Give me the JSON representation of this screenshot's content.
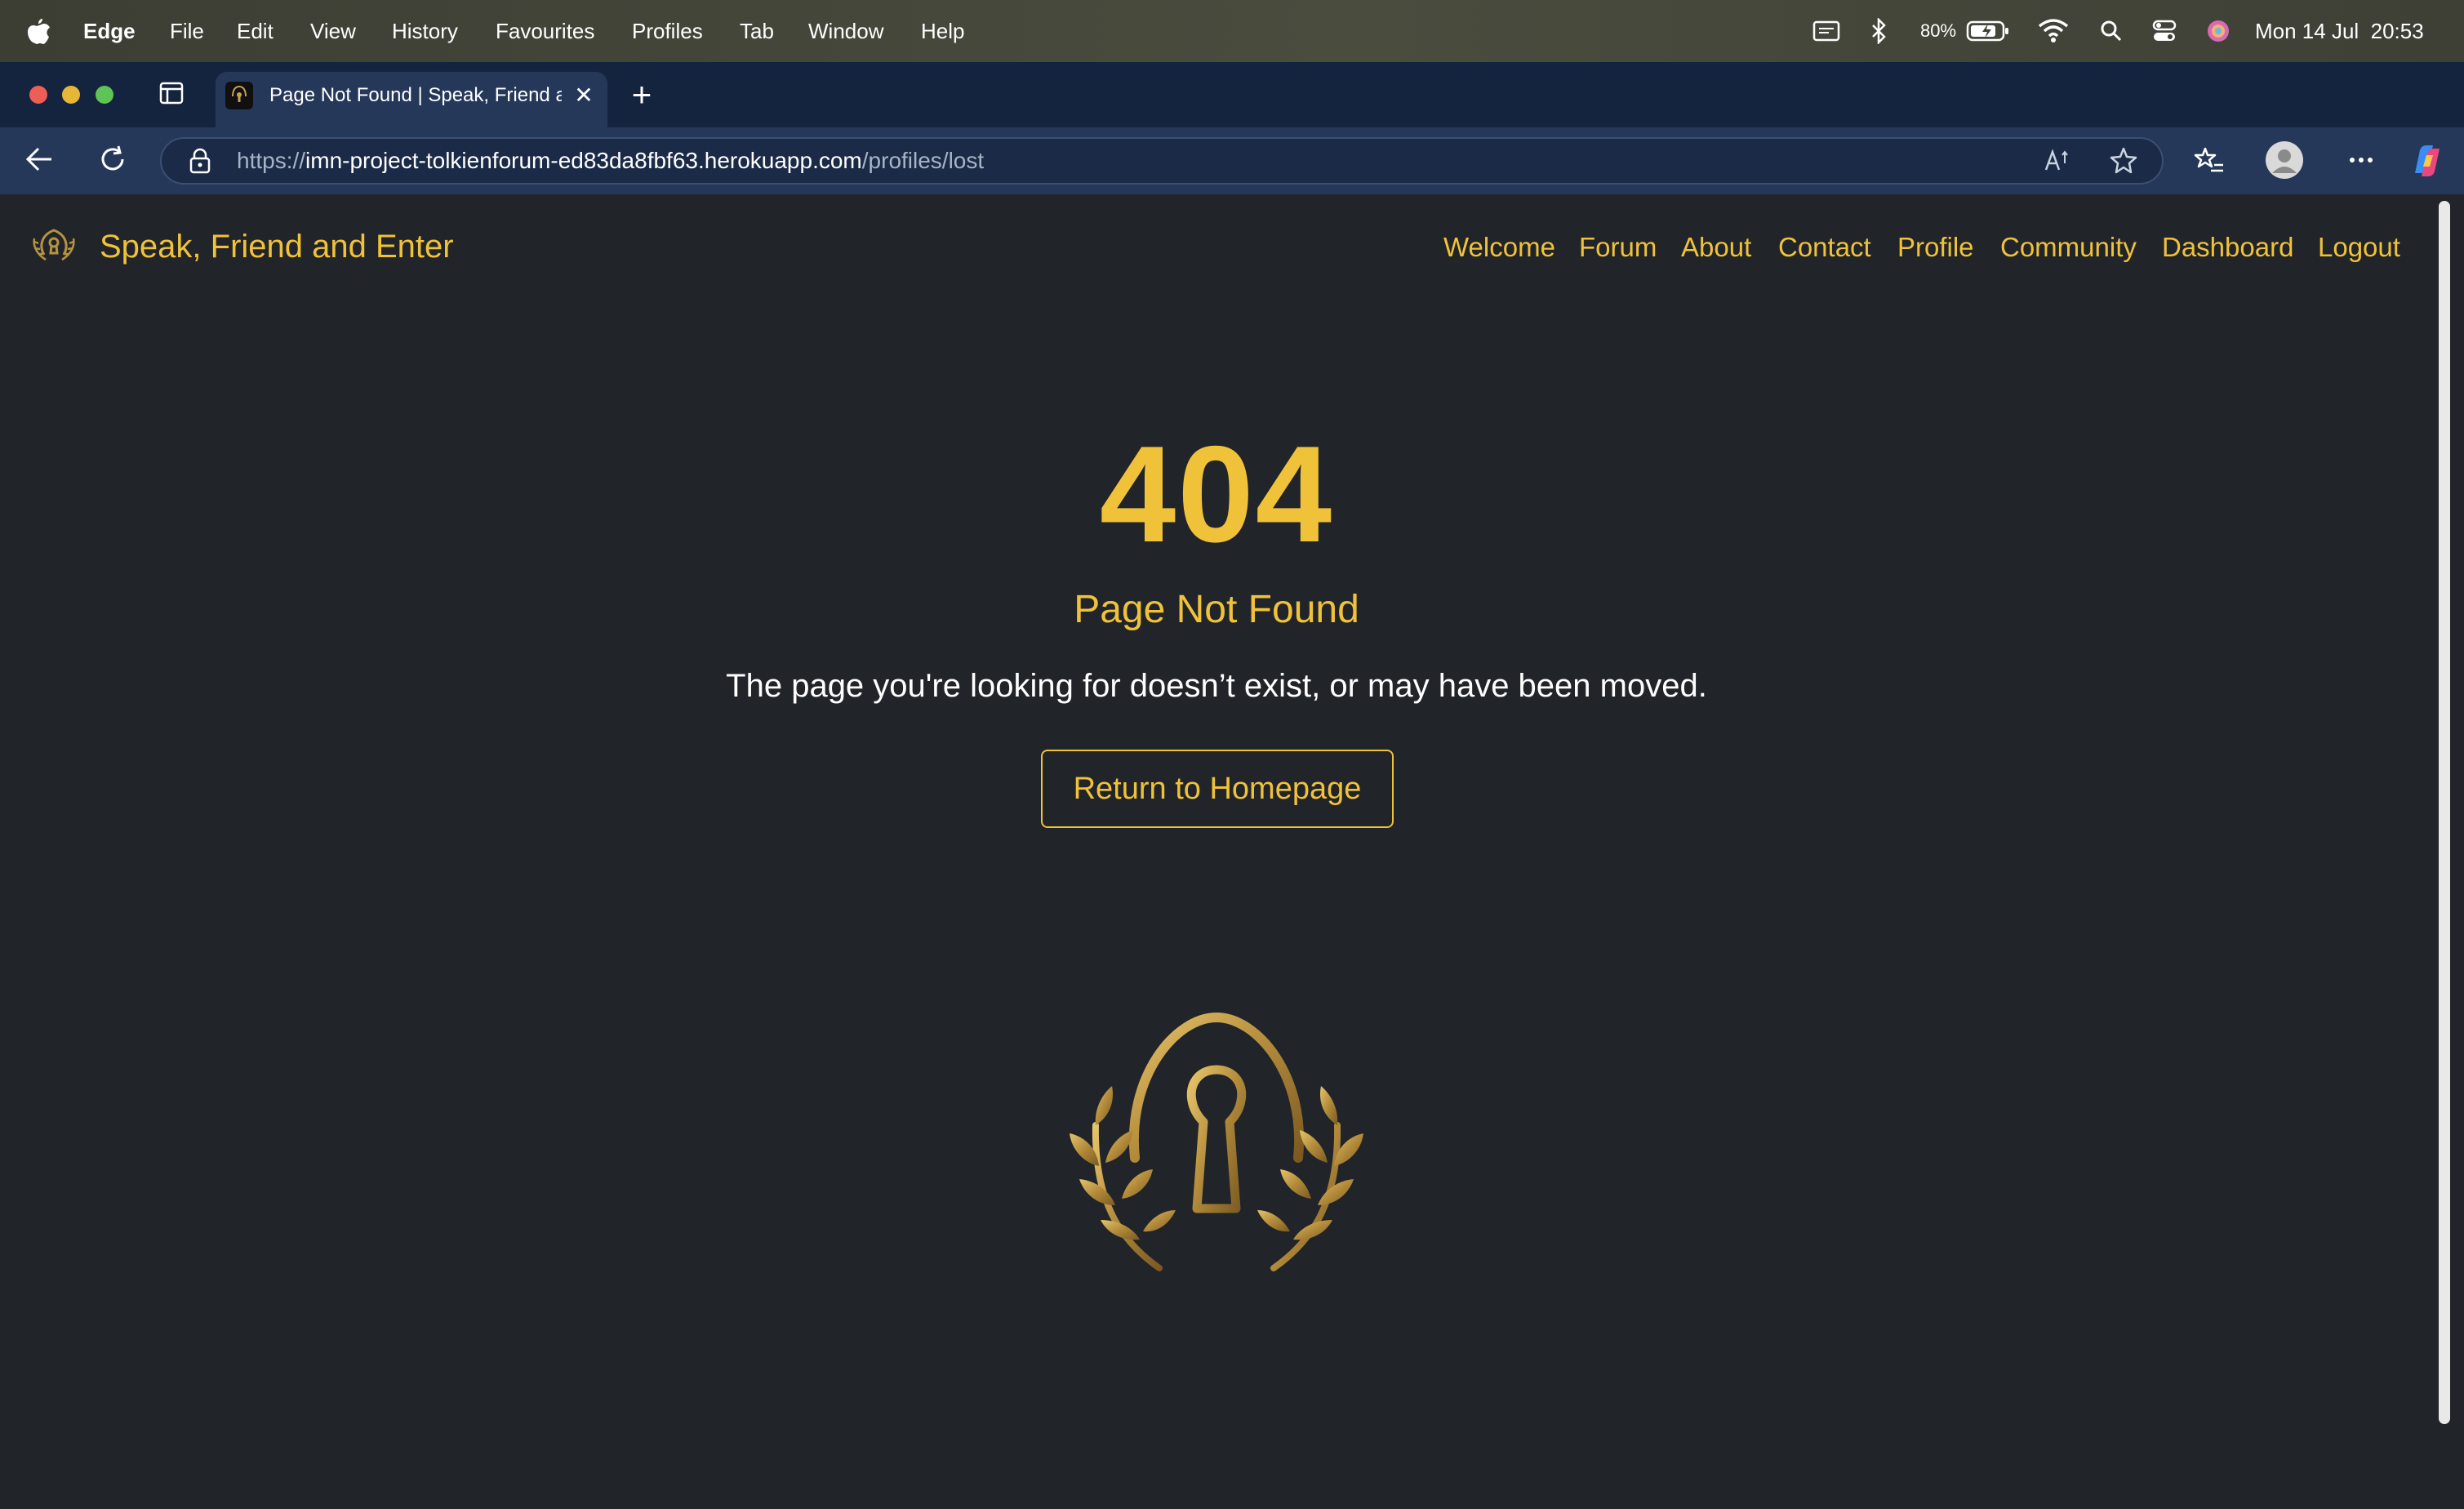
{
  "menubar": {
    "app_name": "Edge",
    "menus": [
      "File",
      "Edit",
      "View",
      "History",
      "Favourites",
      "Profiles",
      "Tab",
      "Window",
      "Help"
    ],
    "battery": "80%",
    "datetime": "Mon 14 Jul  20:53"
  },
  "browser": {
    "tab_title": "Page Not Found | Speak, Friend and Enter",
    "url_scheme": "https://",
    "url_host": "imn-project-tolkienforum-ed83da8fbf63.herokuapp.com",
    "url_path": "/profiles/lost"
  },
  "site": {
    "brand": "Speak, Friend and Enter",
    "nav": [
      "Welcome",
      "Forum",
      "About",
      "Contact",
      "Profile",
      "Community",
      "Dashboard",
      "Logout"
    ]
  },
  "error": {
    "code": "404",
    "title": "Page Not Found",
    "message": "The page you're looking for doesn’t exist, or may have been moved.",
    "button": "Return to Homepage"
  },
  "colors": {
    "accent": "#f0c23a",
    "page_bg": "#212429",
    "tabstrip_bg": "#15243e",
    "toolbar_bg": "#25385a"
  }
}
